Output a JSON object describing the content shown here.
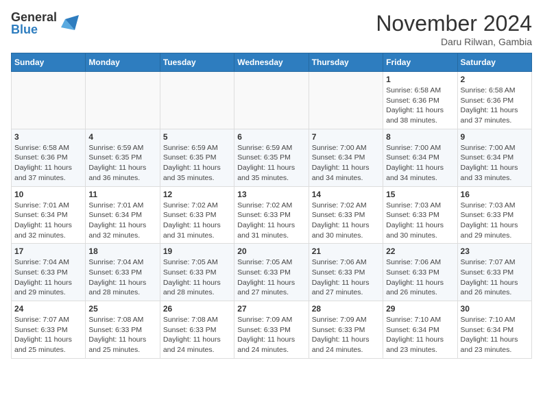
{
  "header": {
    "logo_line1": "General",
    "logo_line2": "Blue",
    "title": "November 2024",
    "subtitle": "Daru Rilwan, Gambia"
  },
  "calendar": {
    "days_of_week": [
      "Sunday",
      "Monday",
      "Tuesday",
      "Wednesday",
      "Thursday",
      "Friday",
      "Saturday"
    ],
    "weeks": [
      [
        {
          "day": "",
          "info": ""
        },
        {
          "day": "",
          "info": ""
        },
        {
          "day": "",
          "info": ""
        },
        {
          "day": "",
          "info": ""
        },
        {
          "day": "",
          "info": ""
        },
        {
          "day": "1",
          "info": "Sunrise: 6:58 AM\nSunset: 6:36 PM\nDaylight: 11 hours and 38 minutes."
        },
        {
          "day": "2",
          "info": "Sunrise: 6:58 AM\nSunset: 6:36 PM\nDaylight: 11 hours and 37 minutes."
        }
      ],
      [
        {
          "day": "3",
          "info": "Sunrise: 6:58 AM\nSunset: 6:36 PM\nDaylight: 11 hours and 37 minutes."
        },
        {
          "day": "4",
          "info": "Sunrise: 6:59 AM\nSunset: 6:35 PM\nDaylight: 11 hours and 36 minutes."
        },
        {
          "day": "5",
          "info": "Sunrise: 6:59 AM\nSunset: 6:35 PM\nDaylight: 11 hours and 35 minutes."
        },
        {
          "day": "6",
          "info": "Sunrise: 6:59 AM\nSunset: 6:35 PM\nDaylight: 11 hours and 35 minutes."
        },
        {
          "day": "7",
          "info": "Sunrise: 7:00 AM\nSunset: 6:34 PM\nDaylight: 11 hours and 34 minutes."
        },
        {
          "day": "8",
          "info": "Sunrise: 7:00 AM\nSunset: 6:34 PM\nDaylight: 11 hours and 34 minutes."
        },
        {
          "day": "9",
          "info": "Sunrise: 7:00 AM\nSunset: 6:34 PM\nDaylight: 11 hours and 33 minutes."
        }
      ],
      [
        {
          "day": "10",
          "info": "Sunrise: 7:01 AM\nSunset: 6:34 PM\nDaylight: 11 hours and 32 minutes."
        },
        {
          "day": "11",
          "info": "Sunrise: 7:01 AM\nSunset: 6:34 PM\nDaylight: 11 hours and 32 minutes."
        },
        {
          "day": "12",
          "info": "Sunrise: 7:02 AM\nSunset: 6:33 PM\nDaylight: 11 hours and 31 minutes."
        },
        {
          "day": "13",
          "info": "Sunrise: 7:02 AM\nSunset: 6:33 PM\nDaylight: 11 hours and 31 minutes."
        },
        {
          "day": "14",
          "info": "Sunrise: 7:02 AM\nSunset: 6:33 PM\nDaylight: 11 hours and 30 minutes."
        },
        {
          "day": "15",
          "info": "Sunrise: 7:03 AM\nSunset: 6:33 PM\nDaylight: 11 hours and 30 minutes."
        },
        {
          "day": "16",
          "info": "Sunrise: 7:03 AM\nSunset: 6:33 PM\nDaylight: 11 hours and 29 minutes."
        }
      ],
      [
        {
          "day": "17",
          "info": "Sunrise: 7:04 AM\nSunset: 6:33 PM\nDaylight: 11 hours and 29 minutes."
        },
        {
          "day": "18",
          "info": "Sunrise: 7:04 AM\nSunset: 6:33 PM\nDaylight: 11 hours and 28 minutes."
        },
        {
          "day": "19",
          "info": "Sunrise: 7:05 AM\nSunset: 6:33 PM\nDaylight: 11 hours and 28 minutes."
        },
        {
          "day": "20",
          "info": "Sunrise: 7:05 AM\nSunset: 6:33 PM\nDaylight: 11 hours and 27 minutes."
        },
        {
          "day": "21",
          "info": "Sunrise: 7:06 AM\nSunset: 6:33 PM\nDaylight: 11 hours and 27 minutes."
        },
        {
          "day": "22",
          "info": "Sunrise: 7:06 AM\nSunset: 6:33 PM\nDaylight: 11 hours and 26 minutes."
        },
        {
          "day": "23",
          "info": "Sunrise: 7:07 AM\nSunset: 6:33 PM\nDaylight: 11 hours and 26 minutes."
        }
      ],
      [
        {
          "day": "24",
          "info": "Sunrise: 7:07 AM\nSunset: 6:33 PM\nDaylight: 11 hours and 25 minutes."
        },
        {
          "day": "25",
          "info": "Sunrise: 7:08 AM\nSunset: 6:33 PM\nDaylight: 11 hours and 25 minutes."
        },
        {
          "day": "26",
          "info": "Sunrise: 7:08 AM\nSunset: 6:33 PM\nDaylight: 11 hours and 24 minutes."
        },
        {
          "day": "27",
          "info": "Sunrise: 7:09 AM\nSunset: 6:33 PM\nDaylight: 11 hours and 24 minutes."
        },
        {
          "day": "28",
          "info": "Sunrise: 7:09 AM\nSunset: 6:33 PM\nDaylight: 11 hours and 24 minutes."
        },
        {
          "day": "29",
          "info": "Sunrise: 7:10 AM\nSunset: 6:34 PM\nDaylight: 11 hours and 23 minutes."
        },
        {
          "day": "30",
          "info": "Sunrise: 7:10 AM\nSunset: 6:34 PM\nDaylight: 11 hours and 23 minutes."
        }
      ]
    ]
  }
}
